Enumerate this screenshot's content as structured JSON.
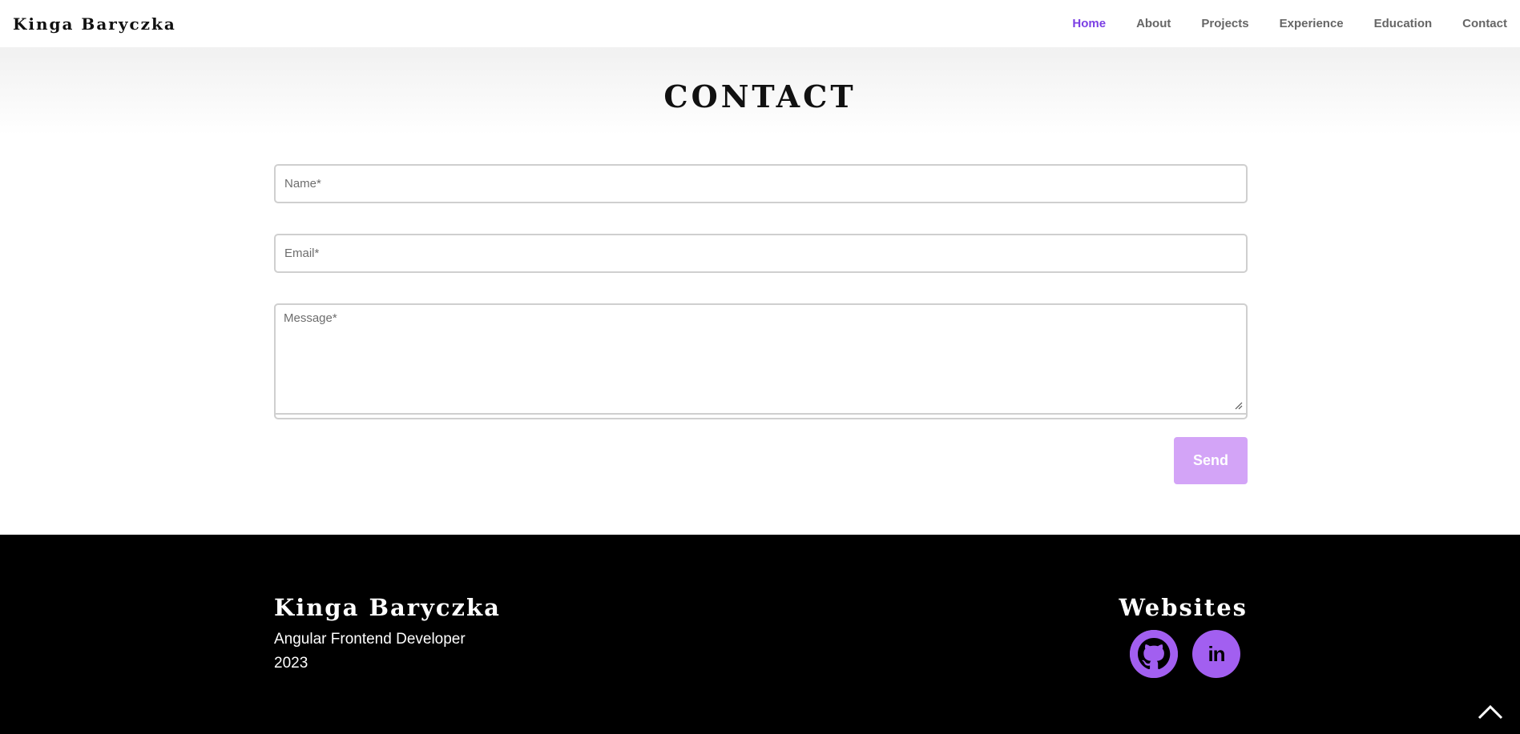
{
  "header": {
    "brand": "Kinga Baryczka",
    "nav": [
      {
        "label": "Home",
        "active": true
      },
      {
        "label": "About",
        "active": false
      },
      {
        "label": "Projects",
        "active": false
      },
      {
        "label": "Experience",
        "active": false
      },
      {
        "label": "Education",
        "active": false
      },
      {
        "label": "Contact",
        "active": false
      }
    ]
  },
  "contact": {
    "title": "CONTACT",
    "name_placeholder": "Name*",
    "email_placeholder": "Email*",
    "message_placeholder": "Message*",
    "send_label": "Send"
  },
  "footer": {
    "name": "Kinga Baryczka",
    "role": "Angular Frontend Developer",
    "year": "2023",
    "websites_title": "Websites",
    "links": [
      {
        "name": "github",
        "icon": "github-icon"
      },
      {
        "name": "linkedin",
        "icon": "linkedin-icon",
        "text": "in"
      }
    ]
  },
  "colors": {
    "accent": "#7b3fe4",
    "button": "#d3a4f7",
    "social": "#a25ff0",
    "footer_bg": "#000000"
  },
  "icons": {
    "scroll_top": "chevron-up-icon",
    "resize": "resize-handle-icon"
  }
}
